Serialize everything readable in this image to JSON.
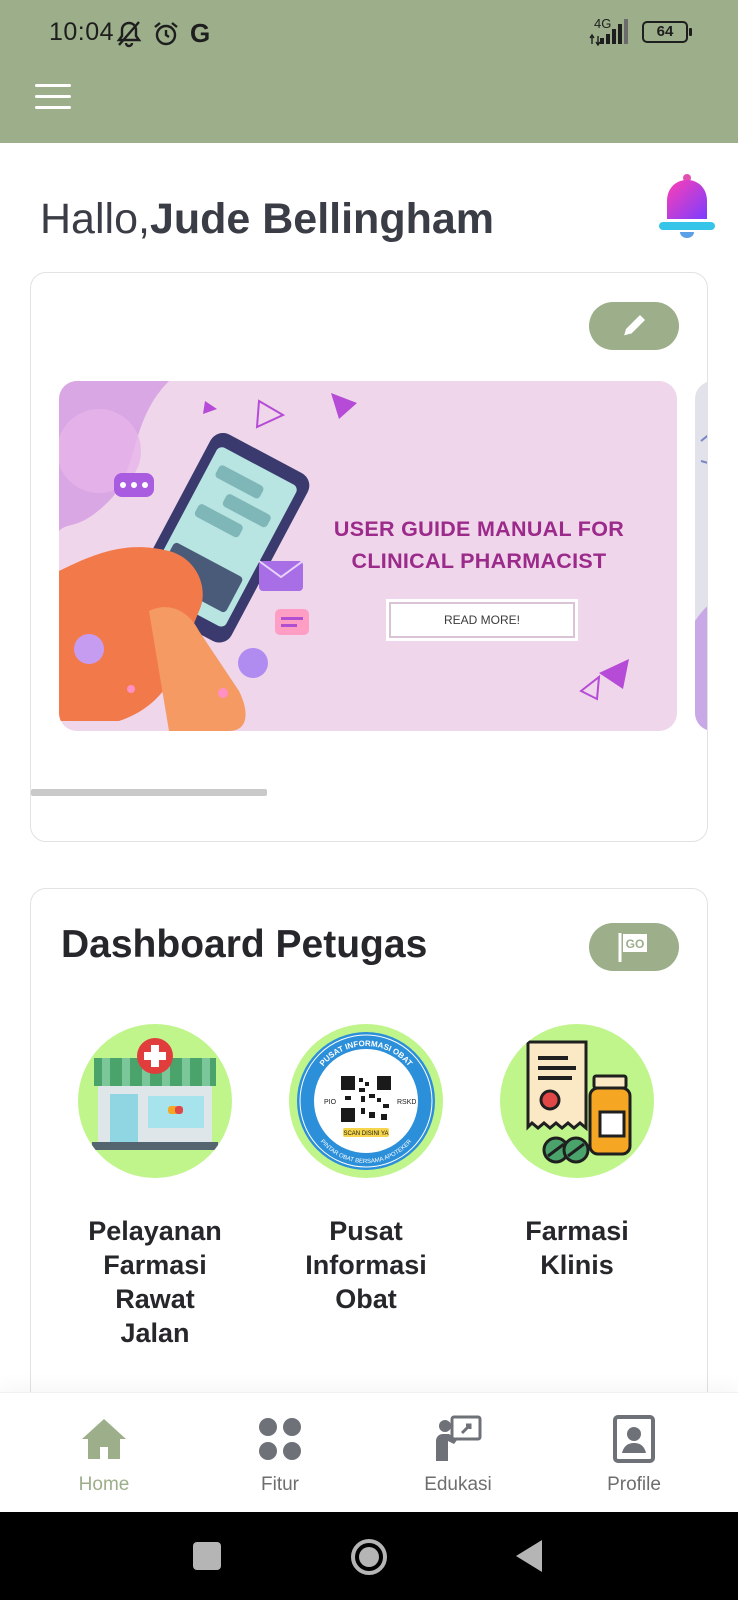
{
  "status_bar": {
    "time": "10:04",
    "g_label": "G",
    "network": "4G",
    "battery": "64"
  },
  "greeting": {
    "prefix": "Hallo,",
    "name": "Jude Bellingham"
  },
  "banner": {
    "title_line1": "USER GUIDE MANUAL FOR",
    "title_line2": "CLINICAL PHARMACIST",
    "button_label": "READ MORE!"
  },
  "dashboard": {
    "title": "Dashboard Petugas",
    "go_label": "GO",
    "items": [
      {
        "label_lines": [
          "Pelayanan",
          "Farmasi",
          "Rawat",
          "Jalan"
        ],
        "icon": "pharmacy-store-icon"
      },
      {
        "label_lines": [
          "Pusat",
          "Informasi",
          "Obat"
        ],
        "icon": "qr-badge-icon"
      },
      {
        "label_lines": [
          "Farmasi",
          "Klinis"
        ],
        "icon": "prescription-medicine-icon"
      }
    ],
    "qr_badge_text_top": "PUSAT INFORMASI OBAT",
    "qr_badge_text_left": "PIO",
    "qr_badge_text_right": "RSKD",
    "qr_badge_text_scan": "SCAN DISINI YA",
    "qr_badge_text_bottom": "PINTAR OBAT BERSAMA APOTEKER"
  },
  "bottom_nav": [
    {
      "label": "Home",
      "icon": "home-icon",
      "active": true
    },
    {
      "label": "Fitur",
      "icon": "grid-icon",
      "active": false
    },
    {
      "label": "Edukasi",
      "icon": "education-icon",
      "active": false
    },
    {
      "label": "Profile",
      "icon": "profile-icon",
      "active": false
    }
  ],
  "colors": {
    "app_bar": "#9cae8a",
    "accent_green": "#9cae8a",
    "menu_circle": "#bff58a",
    "banner_bg": "#efd6ea",
    "banner_title": "#9b2a8b"
  }
}
